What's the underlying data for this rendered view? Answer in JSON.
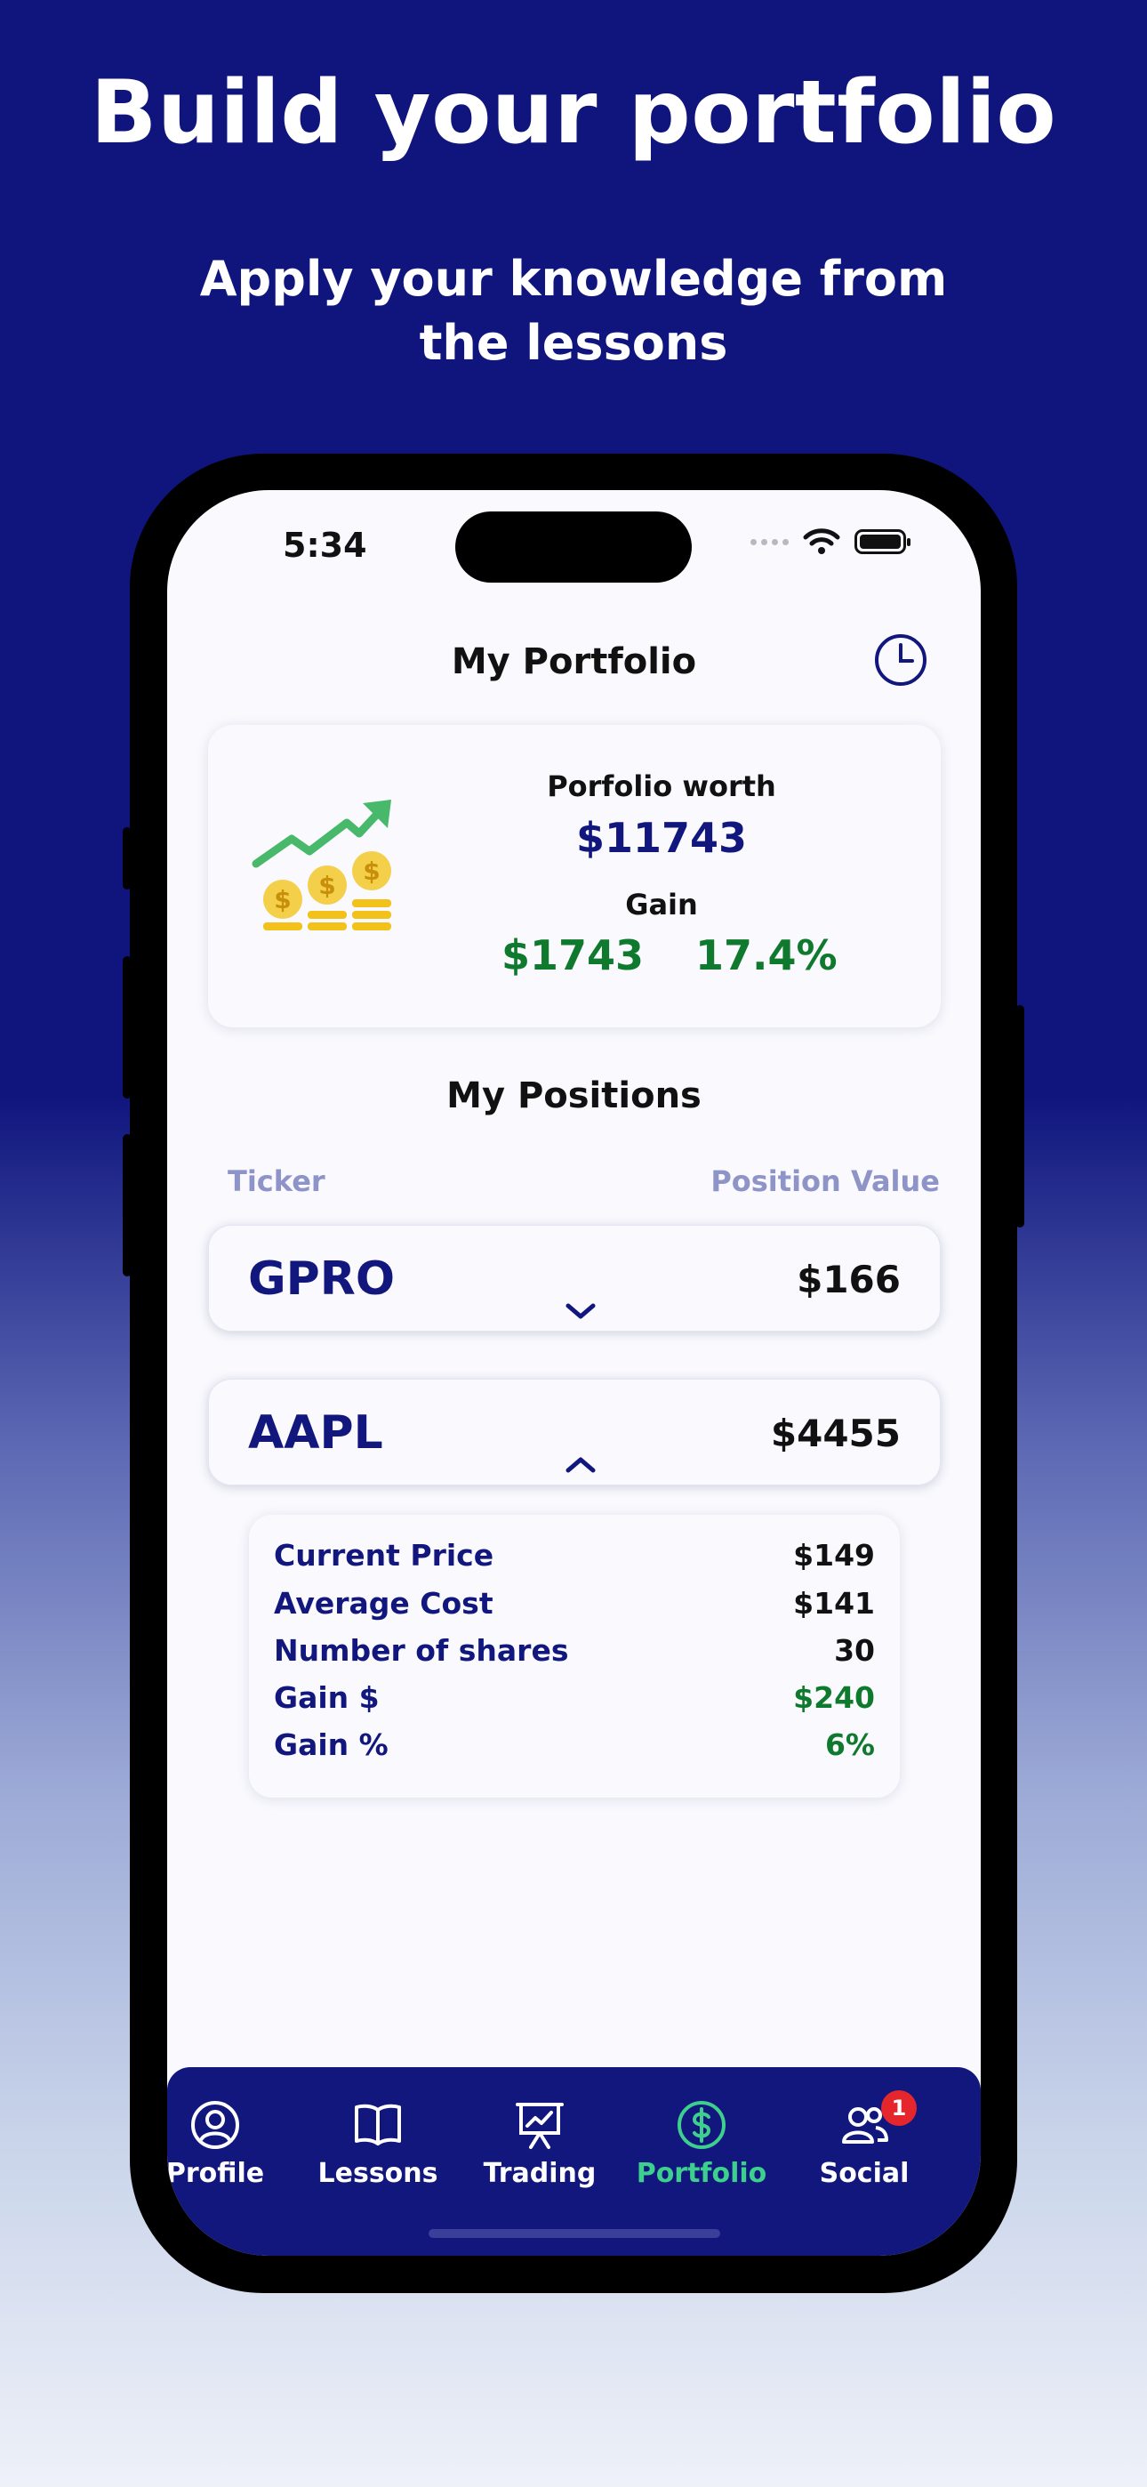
{
  "promo": {
    "headline": "Build your portfolio",
    "subheadline": "Apply your knowledge from the lessons"
  },
  "status_bar": {
    "time": "5:34"
  },
  "header": {
    "title": "My Portfolio",
    "history_icon": "clock-icon"
  },
  "summary": {
    "worth_label": "Porfolio worth",
    "worth_value": "$11743",
    "gain_label": "Gain",
    "gain_amount": "$1743",
    "gain_percent": "17.4%",
    "illustration_icon": "coins-growth-icon"
  },
  "positions": {
    "title": "My Positions",
    "col_ticker": "Ticker",
    "col_value": "Position Value",
    "items": [
      {
        "ticker": "GPRO",
        "value": "$166",
        "expanded": false
      },
      {
        "ticker": "AAPL",
        "value": "$4455",
        "expanded": true,
        "details": [
          {
            "label": "Current Price",
            "value": "$149"
          },
          {
            "label": "Average Cost",
            "value": "$141"
          },
          {
            "label": "Number of shares",
            "value": "30"
          },
          {
            "label": "Gain $",
            "value": "$240"
          },
          {
            "label": "Gain %",
            "value": "6%"
          }
        ]
      }
    ]
  },
  "tabbar": {
    "tabs": [
      {
        "label": "Profile",
        "icon": "user-circle-icon"
      },
      {
        "label": "Lessons",
        "icon": "book-icon"
      },
      {
        "label": "Trading",
        "icon": "chart-board-icon"
      },
      {
        "label": "Portfolio",
        "icon": "dollar-circle-icon",
        "active": true
      },
      {
        "label": "Social",
        "icon": "users-icon",
        "badge": "1"
      }
    ]
  },
  "colors": {
    "brand_navy": "#12177e",
    "gain_green": "#0f7a2e",
    "active_tab": "#3ecf8e",
    "badge_red": "#e5262c"
  }
}
